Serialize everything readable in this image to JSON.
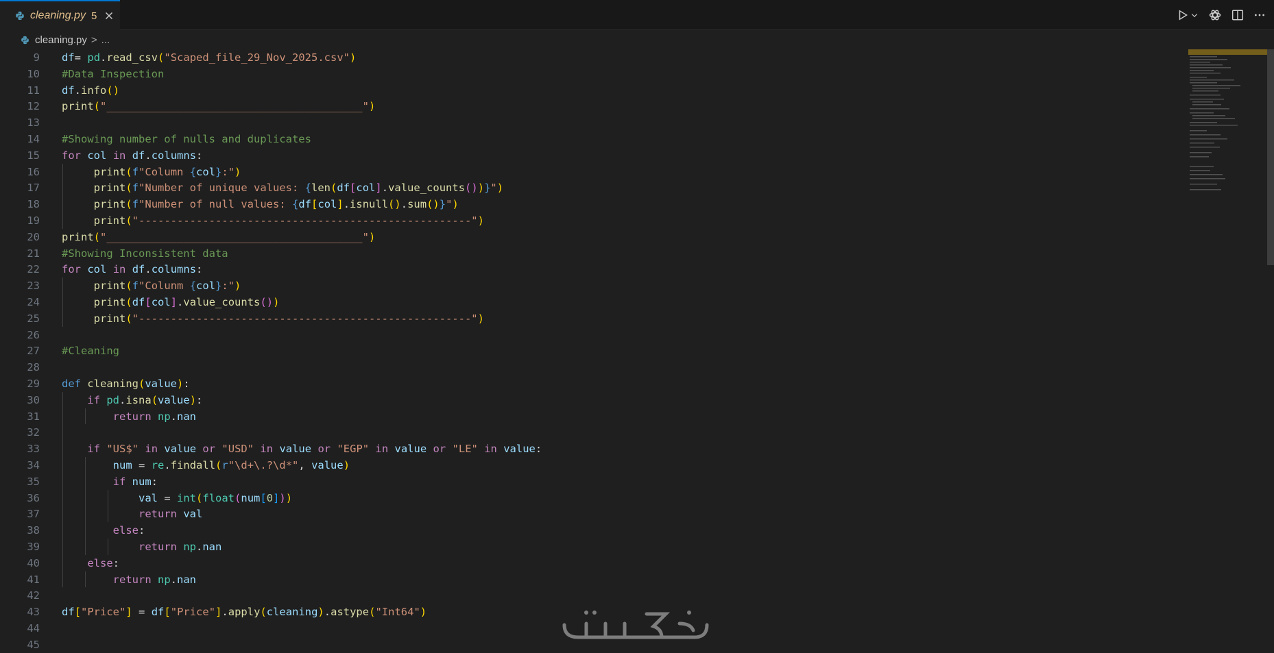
{
  "tab": {
    "filename": "cleaning.py",
    "problems_count": "5"
  },
  "breadcrumb": {
    "file": "cleaning.py",
    "separator": ">",
    "ellipsis": "..."
  },
  "header_actions": [
    "run-icon",
    "chevron-down-icon",
    "openai-icon",
    "split-editor-icon",
    "more-actions-icon"
  ],
  "code": {
    "language": "python",
    "lines": [
      {
        "n": "9",
        "text": "df= pd.read_csv(\"Scaped_file_29_Nov_2025.csv\")"
      },
      {
        "n": "10",
        "text": "#Data Inspection"
      },
      {
        "n": "11",
        "text": "df.info()"
      },
      {
        "n": "12",
        "text": "print(\"________________________________________\")"
      },
      {
        "n": "13",
        "text": ""
      },
      {
        "n": "14",
        "text": "#Showing number of nulls and duplicates"
      },
      {
        "n": "15",
        "text": "for col in df.columns:"
      },
      {
        "n": "16",
        "text": "     print(f\"Column {col}:\")"
      },
      {
        "n": "17",
        "text": "     print(f\"Number of unique values: {len(df[col].value_counts())}\")"
      },
      {
        "n": "18",
        "text": "     print(f\"Number of null values: {df[col].isnull().sum()}\")"
      },
      {
        "n": "19",
        "text": "     print(\"----------------------------------------------------\")"
      },
      {
        "n": "20",
        "text": "print(\"________________________________________\")"
      },
      {
        "n": "21",
        "text": "#Showing Inconsistent data"
      },
      {
        "n": "22",
        "text": "for col in df.columns:"
      },
      {
        "n": "23",
        "text": "     print(f\"Colunm {col}:\")"
      },
      {
        "n": "24",
        "text": "     print(df[col].value_counts())"
      },
      {
        "n": "25",
        "text": "     print(\"----------------------------------------------------\")"
      },
      {
        "n": "26",
        "text": ""
      },
      {
        "n": "27",
        "text": "#Cleaning"
      },
      {
        "n": "28",
        "text": ""
      },
      {
        "n": "29",
        "text": "def cleaning(value):"
      },
      {
        "n": "30",
        "text": "    if pd.isna(value):"
      },
      {
        "n": "31",
        "text": "        return np.nan"
      },
      {
        "n": "32",
        "text": ""
      },
      {
        "n": "33",
        "text": "    if \"US$\" in value or \"USD\" in value or \"EGP\" in value or \"LE\" in value:"
      },
      {
        "n": "34",
        "text": "        num = re.findall(r\"\\d+\\.?\\d*\", value)"
      },
      {
        "n": "35",
        "text": "        if num:"
      },
      {
        "n": "36",
        "text": "            val = int(float(num[0]))"
      },
      {
        "n": "37",
        "text": "            return val"
      },
      {
        "n": "38",
        "text": "        else:"
      },
      {
        "n": "39",
        "text": "            return np.nan"
      },
      {
        "n": "40",
        "text": "    else:"
      },
      {
        "n": "41",
        "text": "        return np.nan"
      },
      {
        "n": "42",
        "text": ""
      },
      {
        "n": "43",
        "text": "df[\"Price\"] = df[\"Price\"].apply(cleaning).astype(\"Int64\")"
      },
      {
        "n": "44",
        "text": ""
      },
      {
        "n": "45",
        "text": ""
      }
    ]
  },
  "colors": {
    "editor_bg": "#1f1f1f",
    "tabbar_bg": "#181818",
    "active_tab_border": "#0078d4",
    "modified_tab_text": "#e2c08d",
    "line_number": "#6e7681"
  }
}
